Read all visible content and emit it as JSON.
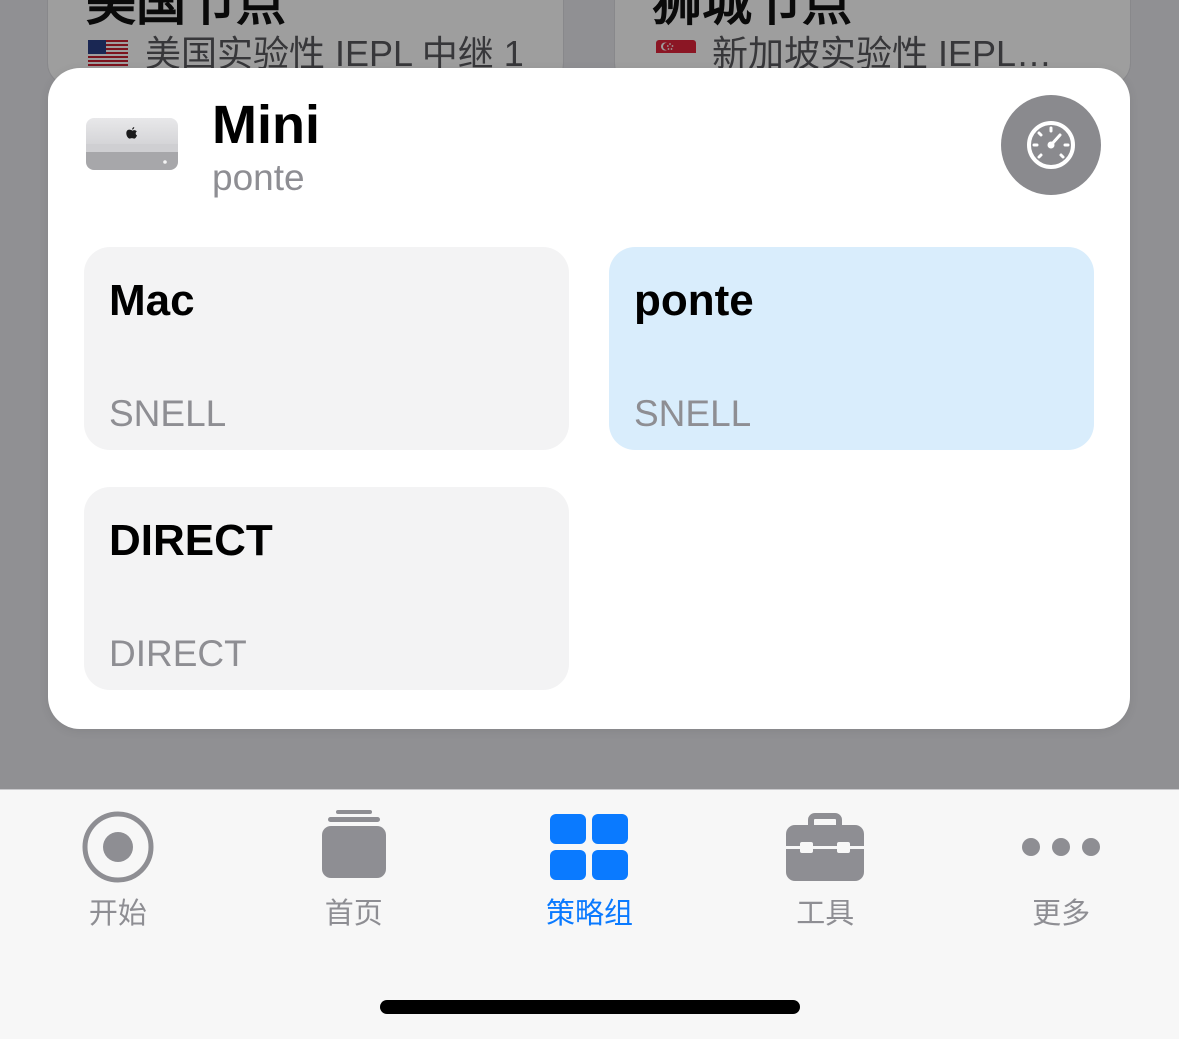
{
  "background": {
    "cards": [
      {
        "title": "美国节点",
        "flag_icon": "us-flag-icon",
        "subtitle": "美国实验性 IEPL 中继 1"
      },
      {
        "title": "狮城节点",
        "flag_icon": "sg-flag-icon",
        "subtitle": "新加坡实验性 IEPL…"
      }
    ]
  },
  "popup": {
    "device_icon": "mac-mini-icon",
    "title": "Mini",
    "subtitle": "ponte",
    "action_icon": "speedometer-icon",
    "options": [
      {
        "name": "Mac",
        "protocol": "SNELL",
        "selected": false
      },
      {
        "name": "ponte",
        "protocol": "SNELL",
        "selected": true
      },
      {
        "name": "DIRECT",
        "protocol": "DIRECT",
        "selected": false
      }
    ]
  },
  "tab_bar": {
    "items": [
      {
        "label": "开始",
        "icon": "record-icon",
        "active": false
      },
      {
        "label": "首页",
        "icon": "stack-icon",
        "active": false
      },
      {
        "label": "策略组",
        "icon": "grid-icon",
        "active": true
      },
      {
        "label": "工具",
        "icon": "toolbox-icon",
        "active": false
      },
      {
        "label": "更多",
        "icon": "more-icon",
        "active": false
      }
    ]
  },
  "colors": {
    "accent": "#0A7AFF",
    "selected_option_bg": "#D9EDFC",
    "option_bg": "#F3F3F4",
    "inactive_tab": "#8E8E93",
    "secondary_text": "#8E8E93",
    "speed_button_bg": "#8A8A8E"
  }
}
